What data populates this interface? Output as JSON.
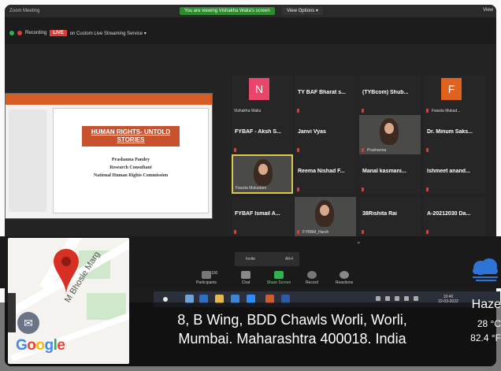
{
  "window": {
    "title": "Zoom Meeting"
  },
  "banner": {
    "viewing_text": "You are viewing Vishakha Walia's screen",
    "view_options": "View Options ▾",
    "view_button": "View"
  },
  "recording": {
    "label": "Recording",
    "live_badge": "LIVE",
    "service": "on Custom Live Streaming Service ▾"
  },
  "slide": {
    "title": "HUMAN RIGHTS- UNTOLD STORIES",
    "lines": [
      "Prashanna Pandey",
      "Research Consultant",
      "National Human Rights Commission"
    ]
  },
  "participants": [
    {
      "name": "Vishakha Walia",
      "avatar": "N",
      "color": "#e8466b",
      "muted": false,
      "label_small": true
    },
    {
      "name": "TY BAF Bharat s...",
      "muted": true
    },
    {
      "name": "(TYBcom) Shub...",
      "muted": true
    },
    {
      "name": "Fawzia Mukad...",
      "avatar": "F",
      "color": "#e0621f",
      "muted": true,
      "label_small": true
    },
    {
      "name": "FYBAF - Aksh S...",
      "muted": true
    },
    {
      "name": "Janvi Vyas",
      "muted": true
    },
    {
      "name": "Prashanna",
      "video": true,
      "muted": true,
      "label_small": true
    },
    {
      "name": "Dr. Minum Saks...",
      "muted": true
    },
    {
      "name": "Fawzia Mukadam",
      "video": true,
      "active": true,
      "label_small": true
    },
    {
      "name": "Reema Nishad F...",
      "muted": true
    },
    {
      "name": "Manal kasmani...",
      "muted": true
    },
    {
      "name": "Ishmeet anand...",
      "muted": true
    },
    {
      "name": "FYBAF Ismail A...",
      "muted": true
    },
    {
      "name": "FYBBM_Harsh",
      "video": true,
      "muted": true,
      "label_small": true
    },
    {
      "name": "38Rishita Rai",
      "muted": true
    },
    {
      "name": "A-20212030 Da...",
      "muted": true
    }
  ],
  "toolbar": {
    "invite_label": "Invite",
    "invite_shortcut": "Alt+I",
    "participants_count": "100",
    "buttons": [
      "Participants",
      "Chat",
      "Share Screen",
      "Record",
      "Reactions"
    ]
  },
  "taskbar": {
    "time": "10:40",
    "date": "22-03-2022"
  },
  "location": {
    "address_line1": "8, B Wing, BDD Chawls Worli, Worli,",
    "address_line2": "Mumbai. Maharashtra 400018. India"
  },
  "weather": {
    "condition": "Haze",
    "temp_c": "28 °C",
    "temp_f": "82.4 °F"
  },
  "map": {
    "street": "M Bhosle Marg",
    "brand": "Google"
  },
  "colors": {
    "accent_green": "#2d8a2d",
    "live_red": "#e23b3b",
    "slide_orange": "#c8522d",
    "active_border": "#d9c94f"
  }
}
